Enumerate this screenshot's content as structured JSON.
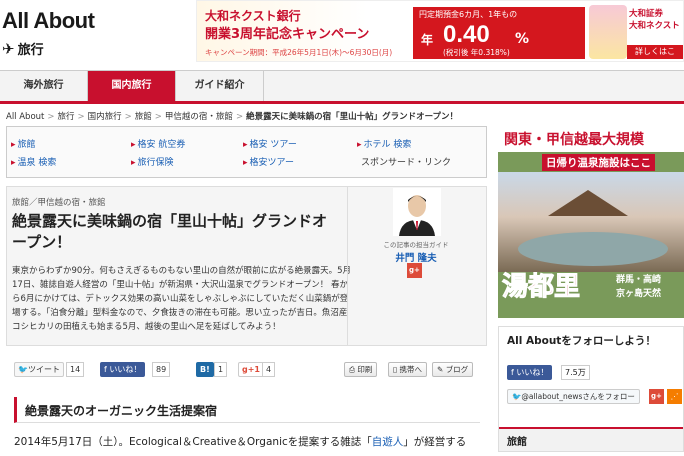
{
  "header": {
    "brand": "All About",
    "section": "旅行"
  },
  "banner": {
    "line1": "大和ネクスト銀行",
    "line2": "開業3周年記念キャンペーン",
    "period": "キャンペーン期間：平成26年5月1日(木)～6月30日(月)",
    "rate_caption": "円定期預金6カ月、1年もの",
    "rate_prefix": "年",
    "rate_value": "0.40",
    "rate_unit": "%",
    "rate_note": "(税引後 年0.318%)",
    "partner_line1": "大和証券",
    "partner_line2": "大和ネクスト",
    "more_label": "詳しくはこ"
  },
  "nav": {
    "tabs": [
      {
        "label": "海外旅行"
      },
      {
        "label": "国内旅行"
      },
      {
        "label": "ガイド紹介"
      }
    ]
  },
  "breadcrumb": {
    "items": [
      "All About",
      "旅行",
      "国内旅行",
      "旅館",
      "甲信越の宿・旅館"
    ],
    "current": "絶景露天に美味鍋の宿「里山十帖」グランドオープン！"
  },
  "links": {
    "items": [
      {
        "label": "旅館"
      },
      {
        "label": "格安 航空券"
      },
      {
        "label": "格安 ツアー"
      },
      {
        "label": "ホテル 検索"
      },
      {
        "label": "温泉 検索"
      },
      {
        "label": "旅行保険"
      },
      {
        "label": "格安ツアー"
      }
    ],
    "sponsored": "スポンサード・リンク"
  },
  "article": {
    "category": "旅館／甲信越の宿・旅館",
    "title": "絶景露天に美味鍋の宿「里山十帖」グランドオープン！",
    "lead": "東京からわずか90分。何もさえぎるものもない里山の自然が眼前に広がる絶景露天。5月17日、雑誌自遊人経営の「里山十帖」が新潟県・大沢山温泉でグランドオープン！ 春から6月にかけては、デトックス効果の高い山菜をしゃぶしゃぶにしていただく山菜鍋が登場する。「泊食分離」型料金なので、夕食抜きの滞在も可能。思い立ったが吉日。魚沼産コシヒカリの田植えも始まる5月、越後の里山へ足を延ばしてみよう！"
  },
  "author": {
    "caption": "この記事の担当ガイド",
    "name": "井門 隆夫",
    "gplus": "g+"
  },
  "social": {
    "tweet_label": "ツイート",
    "tweet_count": "14",
    "fb_label": "いいね！",
    "fb_count": "89",
    "hb_label": "B!",
    "hb_count": "1",
    "gp_label": "g+1",
    "gp_count": "4",
    "print_label": "印刷",
    "mobile_label": "携帯へ",
    "blog_label": "ブログ"
  },
  "section": {
    "heading": "絶景露天のオーガニック生活提案宿"
  },
  "body": {
    "text1": "2014年5月17日（土）。Ecological＆Creative＆Organicを提案する雑誌「",
    "link": "自遊人",
    "text2": "」が経営する"
  },
  "sidebar_ad": {
    "headline": "関東・甲信越最大規模",
    "subline": "日帰り温泉施設はここ",
    "name": "湯都里",
    "loc1": "群馬・高崎",
    "loc2": "京ヶ島天然"
  },
  "follow": {
    "heading": "All Aboutをフォローしよう！",
    "fb_label": "いいね！",
    "fb_count": "7.5万",
    "twitter_label": "@allabout_newsさんをフォロー",
    "gplus": "g+",
    "rss": "⋰",
    "section_heading": "旅館"
  },
  "colors": {
    "accent": "#c8102e",
    "link": "#1a5fb4",
    "facebook": "#3b5998"
  }
}
